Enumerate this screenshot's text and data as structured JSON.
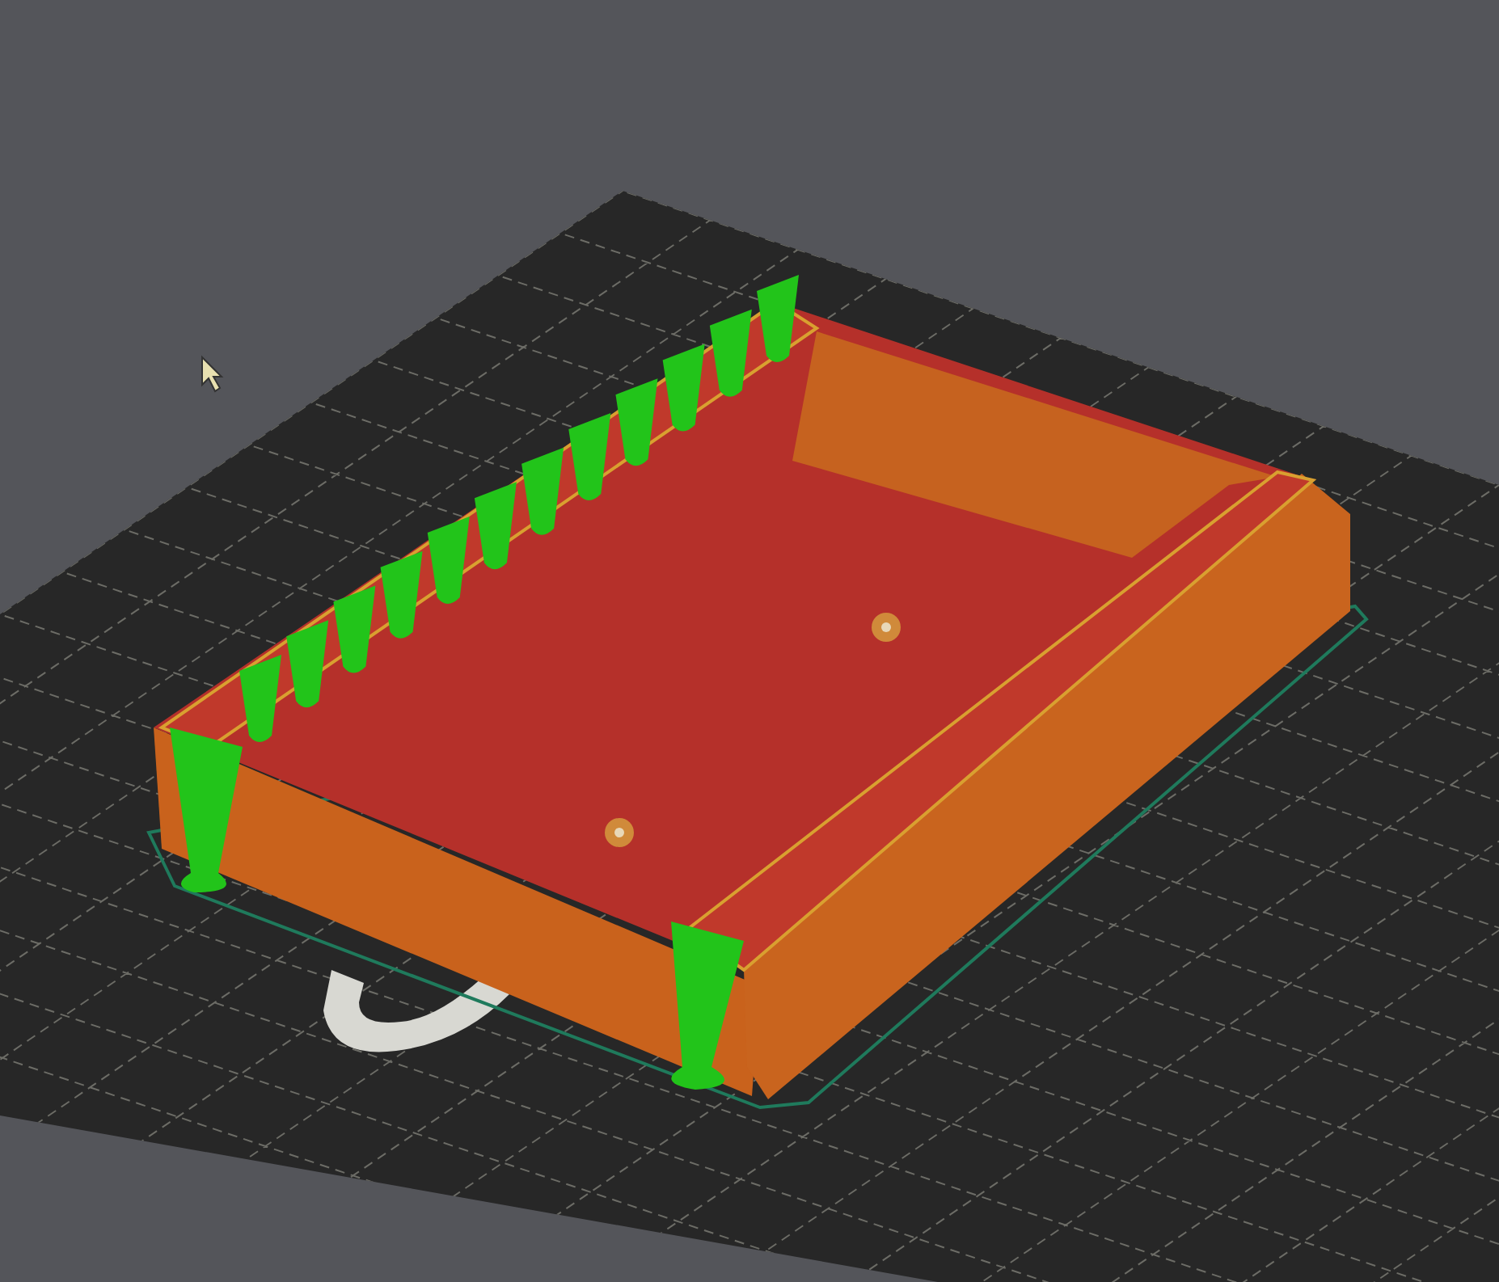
{
  "viewport": {
    "kind": "sliced-model-preview"
  }
}
